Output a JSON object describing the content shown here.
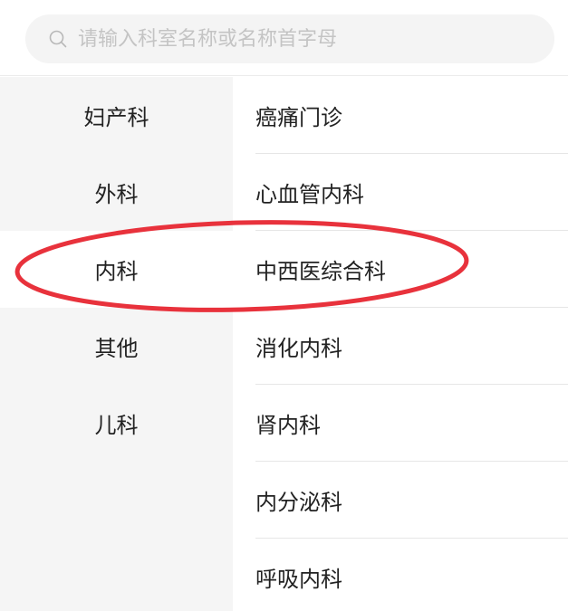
{
  "search": {
    "placeholder": "请输入科室名称或名称首字母",
    "icon": "search-icon"
  },
  "categories": [
    {
      "label": "妇产科",
      "active": false
    },
    {
      "label": "外科",
      "active": false
    },
    {
      "label": "内科",
      "active": true
    },
    {
      "label": "其他",
      "active": false
    },
    {
      "label": "儿科",
      "active": false
    }
  ],
  "departments": [
    {
      "label": "癌痛门诊"
    },
    {
      "label": "心血管内科"
    },
    {
      "label": "中西医综合科"
    },
    {
      "label": "消化内科"
    },
    {
      "label": "肾内科"
    },
    {
      "label": "内分泌科"
    },
    {
      "label": "呼吸内科"
    }
  ],
  "colors": {
    "annotation": "#e8323c",
    "sidebar_bg": "#f5f5f5",
    "search_bg": "#f4f4f4"
  }
}
